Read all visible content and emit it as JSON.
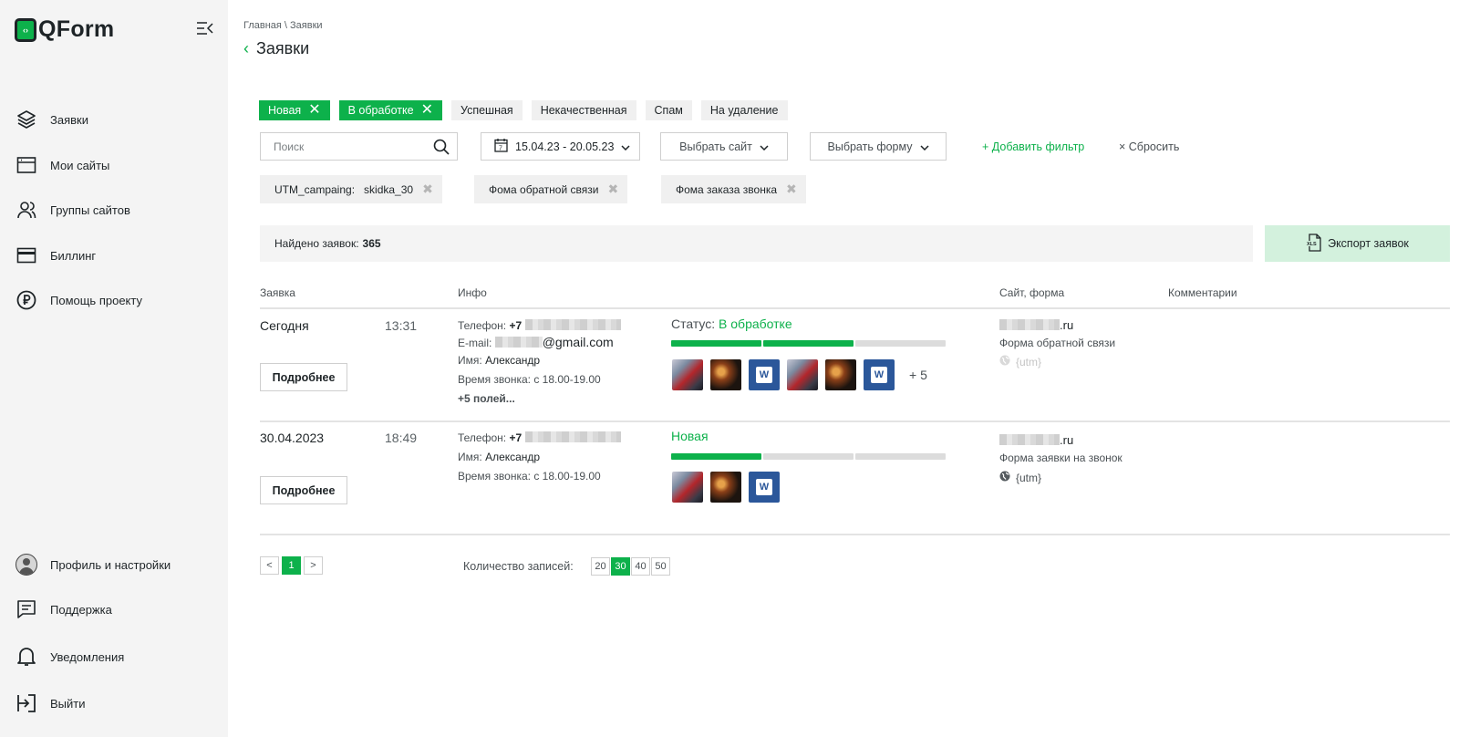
{
  "app": {
    "logo_mark": "‹›",
    "logo_text": "QForm"
  },
  "sidebar": {
    "items": [
      {
        "label": "Заявки",
        "icon": "layers-icon"
      },
      {
        "label": "Мои сайты",
        "icon": "browser-window-icon"
      },
      {
        "label": "Группы сайтов",
        "icon": "users-icon"
      },
      {
        "label": "Биллинг",
        "icon": "credit-card-icon"
      },
      {
        "label": "Помощь проекту",
        "icon": "ruble-coin-icon"
      }
    ],
    "bottom_items": [
      {
        "label": "Профиль и настройки",
        "icon": "avatar-icon"
      },
      {
        "label": "Поддержка",
        "icon": "chat-icon"
      },
      {
        "label": "Уведомления",
        "icon": "bell-icon"
      },
      {
        "label": "Выйти",
        "icon": "logout-icon"
      }
    ]
  },
  "header": {
    "breadcrumb": "Главная \\ Заявки",
    "title": "Заявки"
  },
  "status_chips": [
    {
      "label": "Новая",
      "active": true
    },
    {
      "label": "В обработке",
      "active": true
    },
    {
      "label": "Успешная",
      "active": false
    },
    {
      "label": "Некачественная",
      "active": false
    },
    {
      "label": "Спам",
      "active": false
    },
    {
      "label": "На удаление",
      "active": false
    }
  ],
  "filters": {
    "search_placeholder": "Поиск",
    "date_range": "15.04.23 - 20.05.23",
    "site_select": "Выбрать сайт",
    "form_select": "Выбрать форму",
    "add_filter": "+ Добавить фильтр",
    "reset": "× Сбросить"
  },
  "active_tags": [
    {
      "key": "UTM_campaing:",
      "value": "skidka_30"
    },
    {
      "key": "",
      "value": "Фома обратной связи"
    },
    {
      "key": "",
      "value": "Фома заказа звонка"
    }
  ],
  "summary": {
    "found_label": "Найдено заявок:",
    "found_count": "365",
    "export_label": "Экспорт заявок"
  },
  "table": {
    "columns": [
      "Заявка",
      "Инфо",
      "Сайт, форма",
      "Комментарии"
    ],
    "more_label": "Подробнее",
    "rows": [
      {
        "date": "Сегодня",
        "time": "13:31",
        "phone_label": "Телефон:",
        "phone_prefix": "+7",
        "email_label": "E-mail:",
        "email_suffix": "@gmail.com",
        "name_label": "Имя:",
        "name": "Александр",
        "call_time_label": "Время звонка:",
        "call_time": "с 18.00-19.00",
        "more_fields": "+5 полей...",
        "status_prefix": "Статус:",
        "status": "В обработке",
        "progress_steps": [
          true,
          true,
          false
        ],
        "attachments": [
          "photo1",
          "photo2",
          "doc",
          "photo1",
          "photo2",
          "doc"
        ],
        "attachments_extra": "+ 5",
        "site_suffix": ".ru",
        "form": "Форма обратной связи",
        "utm": "{utm}",
        "utm_muted": true
      },
      {
        "date": "30.04.2023",
        "time": "18:49",
        "phone_label": "Телефон:",
        "phone_prefix": "+7",
        "name_label": "Имя:",
        "name": "Александр",
        "call_time_label": "Время звонка:",
        "call_time": "с 18.00-19.00",
        "status": "Новая",
        "progress_steps": [
          true,
          false,
          false
        ],
        "attachments": [
          "photo1",
          "photo2",
          "doc"
        ],
        "site_suffix": ".ru",
        "form": "Форма заявки на звонок",
        "utm": "{utm}",
        "utm_muted": false
      }
    ]
  },
  "pagination": {
    "prev": "<",
    "current": "1",
    "next": ">",
    "records_label": "Количество записей:",
    "sizes": [
      "20",
      "30",
      "40",
      "50"
    ],
    "selected_size": "30"
  },
  "colors": {
    "accent": "#0db14b",
    "accent_light": "#d3f1dd",
    "sidebar_bg": "#f4f4f4",
    "text": "#1e2427"
  }
}
